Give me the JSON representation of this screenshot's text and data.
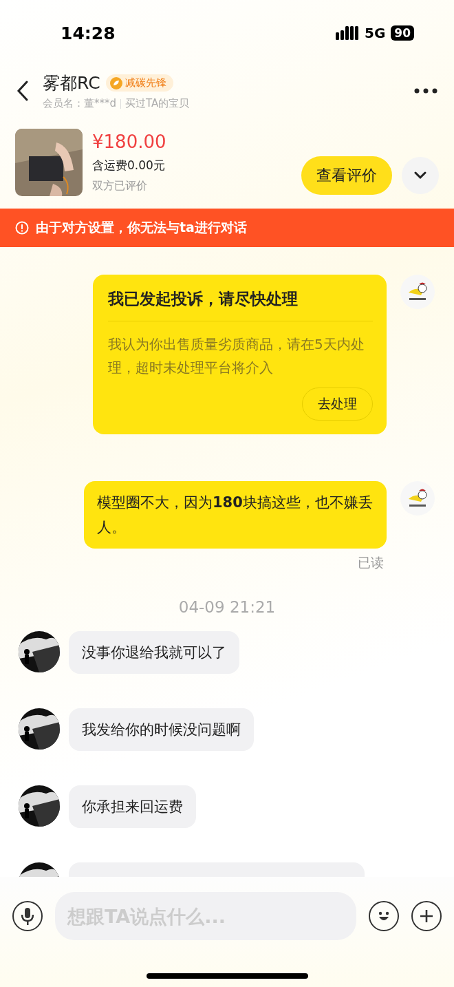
{
  "status_bar": {
    "time": "14:28",
    "network": "5G",
    "battery": "90"
  },
  "header": {
    "name": "雾都RC",
    "badge": "减碳先锋",
    "member": "会员名：董***d",
    "relation": "买过TA的宝贝"
  },
  "order": {
    "price": "¥180.00",
    "shipping": "含运费0.00元",
    "status": "双方已评价",
    "action": "查看评价"
  },
  "notice": {
    "text": "由于对方设置，你无法与ta进行对话"
  },
  "messages": [
    {
      "kind": "card",
      "title": "我已发起投诉，请尽快处理",
      "body": "我认为你出售质量劣质商品，请在5天内处理，超时未处理平台将介入",
      "action": "去处理"
    },
    {
      "kind": "sent",
      "text": "模型圈不大，因为**180**块搞这些，也不嫌丢人。",
      "receipt": "已读"
    },
    {
      "kind": "time",
      "text": "04-09 21:21"
    },
    {
      "kind": "received",
      "text": "没事你退给我就可以了"
    },
    {
      "kind": "received",
      "text": "我发给你的时候没问题啊"
    },
    {
      "kind": "received",
      "text": "你承担来回运费"
    },
    {
      "kind": "received_cut"
    }
  ],
  "input": {
    "placeholder": "想跟TA说点什么..."
  }
}
